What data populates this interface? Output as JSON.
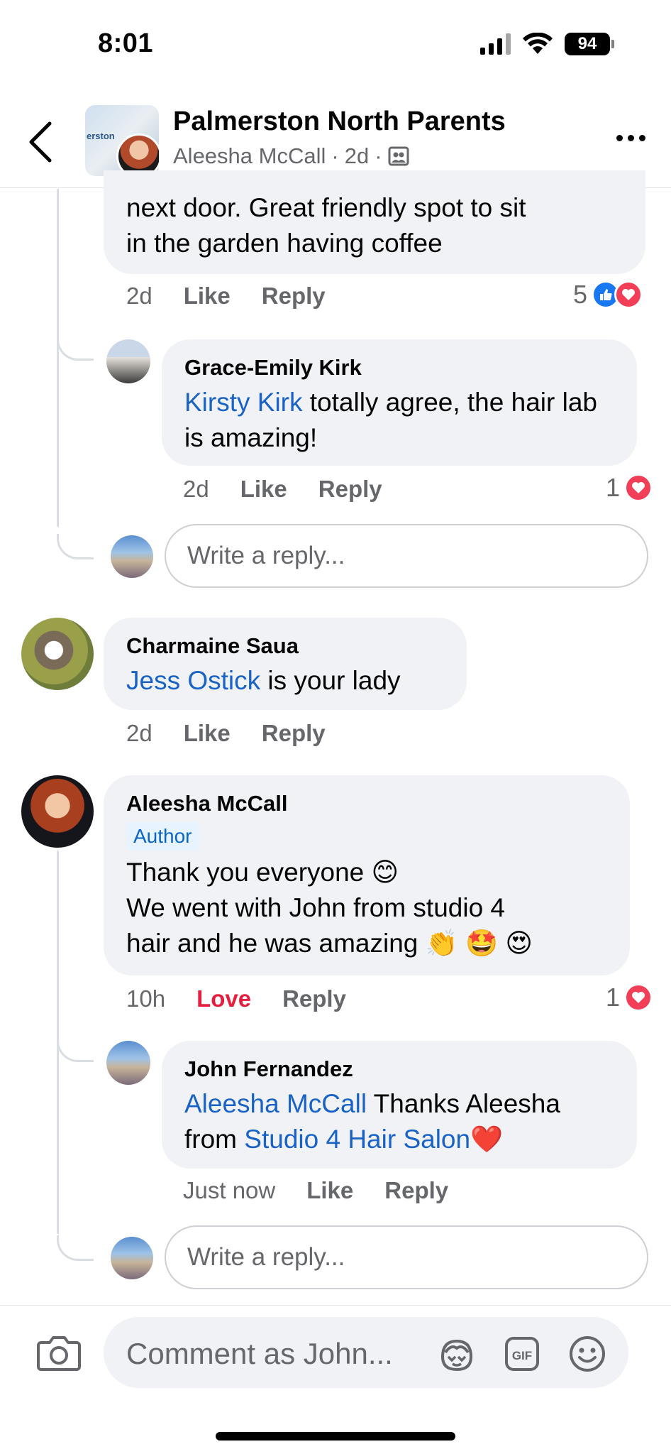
{
  "status_bar": {
    "time": "8:01",
    "battery": "94"
  },
  "header": {
    "group_name": "Palmerston North Parents",
    "avatar_text": "erston",
    "author": "Aleesha McCall",
    "sep1": "·",
    "age": "2d",
    "sep2": "·"
  },
  "comments": [
    {
      "text_line1": "next door. Great friendly spot to sit",
      "text_line2": "in the garden having coffee",
      "time": "2d",
      "like_label": "Like",
      "reply_label": "Reply",
      "reaction_count": "5"
    },
    {
      "name": "Grace-Emily Kirk",
      "mention": "Kirsty Kirk",
      "text": " totally agree, the hair lab is amazing!",
      "time": "2d",
      "like_label": "Like",
      "reply_label": "Reply",
      "reaction_count": "1"
    },
    {
      "name": "Charmaine Saua",
      "mention": "Jess Ostick",
      "text": " is your lady",
      "time": "2d",
      "like_label": "Like",
      "reply_label": "Reply"
    },
    {
      "name": "Aleesha McCall",
      "badge": "Author",
      "line1": "Thank you everyone 😊",
      "line2": "We went with John from studio 4",
      "line3": "hair and he was amazing 👏 🤩 😍",
      "time": "10h",
      "love_label": "Love",
      "reply_label": "Reply",
      "reaction_count": "1"
    },
    {
      "name": "John Fernandez",
      "mention1": "Aleesha McCall",
      "text_mid": " Thanks Aleesha",
      "text_from": "from ",
      "mention2": "Studio 4 Hair Salon",
      "emoji": "❤️",
      "time": "Just now",
      "like_label": "Like",
      "reply_label": "Reply"
    }
  ],
  "reply_placeholder": "Write a reply...",
  "composer": {
    "placeholder": "Comment as John..."
  }
}
